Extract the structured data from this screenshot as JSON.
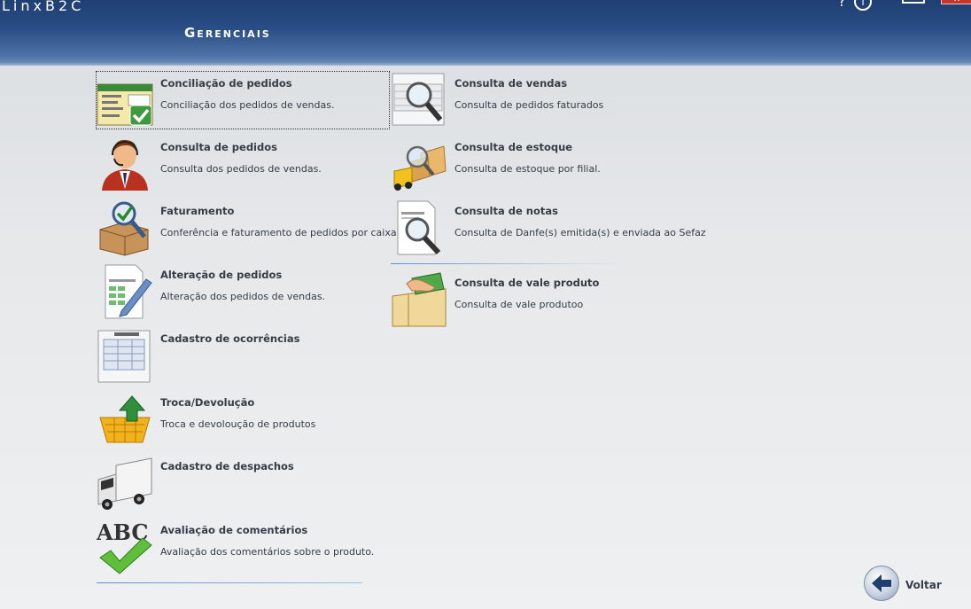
{
  "app": {
    "title": "LinxB2C"
  },
  "page": {
    "section_title": "Gerenciais"
  },
  "header_controls": {
    "help": "?",
    "info": "i",
    "close": "x"
  },
  "menu_left": [
    {
      "title": "Conciliação de pedidos",
      "description": "Conciliação dos pedidos de vendas.",
      "icon": "reconciliation-check-icon"
    },
    {
      "title": "Consulta de pedidos",
      "description": "Consulta dos pedidos de vendas.",
      "icon": "customer-service-agent-icon"
    },
    {
      "title": "Faturamento",
      "description": "Conferência e faturamento de pedidos por caixa.",
      "icon": "box-magnifier-icon"
    },
    {
      "title": "Alteração de pedidos",
      "description": "Alteração dos pedidos de vendas.",
      "icon": "document-edit-pen-icon"
    },
    {
      "title": "Cadastro de ocorrências",
      "description": "",
      "icon": "form-sheet-icon"
    },
    {
      "title": "Troca/Devolução",
      "description": "Troca e devoloução de produtos",
      "icon": "basket-return-arrow-icon"
    },
    {
      "title": "Cadastro de despachos",
      "description": "",
      "icon": "delivery-truck-icon"
    },
    {
      "title": "Avaliação de comentários",
      "description": "Avaliação dos comentários sobre o produto.",
      "icon": "abc-checkmark-icon"
    }
  ],
  "menu_right": [
    {
      "title": "Consulta de vendas",
      "description": "Consulta de pedidos faturados",
      "icon": "sales-magnifier-icon"
    },
    {
      "title": "Consulta de estoque",
      "description": "Consulta de estoque por filial.",
      "icon": "forklift-stock-icon"
    },
    {
      "title": "Consulta de notas",
      "description": "Consulta de Danfe(s) emitida(s) e enviada ao Sefaz",
      "icon": "invoice-magnifier-icon"
    },
    {
      "title": "Consulta de vale produto",
      "description": "Consulta de vale produtoo",
      "icon": "voucher-hand-money-icon"
    }
  ],
  "footer": {
    "back_label": "Voltar"
  },
  "colors": {
    "header_dark": "#1f3f72",
    "header_light": "#6f8fbd",
    "text": "#353d47",
    "separator": "#5b8fd0"
  }
}
